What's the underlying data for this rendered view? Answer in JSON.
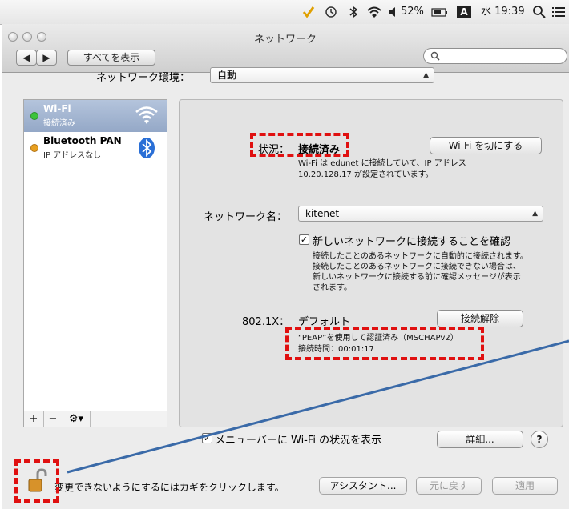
{
  "menubar": {
    "battery": "52%",
    "input_mode": "A",
    "datetime": "水 19:39",
    "icons": [
      "checkmark-icon",
      "time-machine-icon",
      "bluetooth-icon",
      "wifi-icon",
      "volume-icon",
      "battery-icon",
      "input-source-icon",
      "spotlight-icon",
      "list-icon"
    ]
  },
  "window": {
    "title": "ネットワーク",
    "show_all_label": "すべてを表示",
    "search_placeholder": ""
  },
  "location": {
    "label": "ネットワーク環境：",
    "value": "自動"
  },
  "sidebar": {
    "items": [
      {
        "name": "Wi-Fi",
        "status": "接続済み",
        "status_color": "#3cc43c",
        "selected": true
      },
      {
        "name": "Bluetooth PAN",
        "status": "IP アドレスなし",
        "status_color": "#e8a020",
        "selected": false
      }
    ],
    "controls": [
      "+",
      "−",
      "⚙▾"
    ]
  },
  "detail": {
    "status_label": "状況：",
    "status_value": "接続済み",
    "wifi_off_button": "Wi-Fi を切にする",
    "status_desc_1": "Wi-Fi は edunet に接続していて、IP アドレス",
    "status_desc_2": "10.20.128.17 が設定されています。",
    "network_name_label": "ネットワーク名：",
    "network_name_value": "kitenet",
    "ask_join_label": "新しいネットワークに接続することを確認",
    "ask_join_checked": true,
    "ask_join_desc_1": "接続したことのあるネットワークに自動的に接続されます。",
    "ask_join_desc_2": "接続したことのあるネットワークに接続できない場合は、",
    "ask_join_desc_3": "新しいネットワークに接続する前に確認メッセージが表示",
    "ask_join_desc_4": "されます。",
    "dot1x_label": "802.1X：",
    "dot1x_value": "デフォルト",
    "disconnect_button": "接続解除",
    "auth_line_1": "“PEAP”を使用して認証済み（MSCHAPv2）",
    "auth_line_2": "接続時間：00:01:17",
    "show_menu_label": "メニューバーに Wi-Fi の状況を表示",
    "show_menu_checked": true,
    "advanced_button": "詳細...",
    "help_button": "?"
  },
  "bottom": {
    "lock_text": "変更できないようにするにはカギをクリックします。",
    "assistant_button": "アシスタント...",
    "revert_button": "元に戻す",
    "apply_button": "適用"
  }
}
